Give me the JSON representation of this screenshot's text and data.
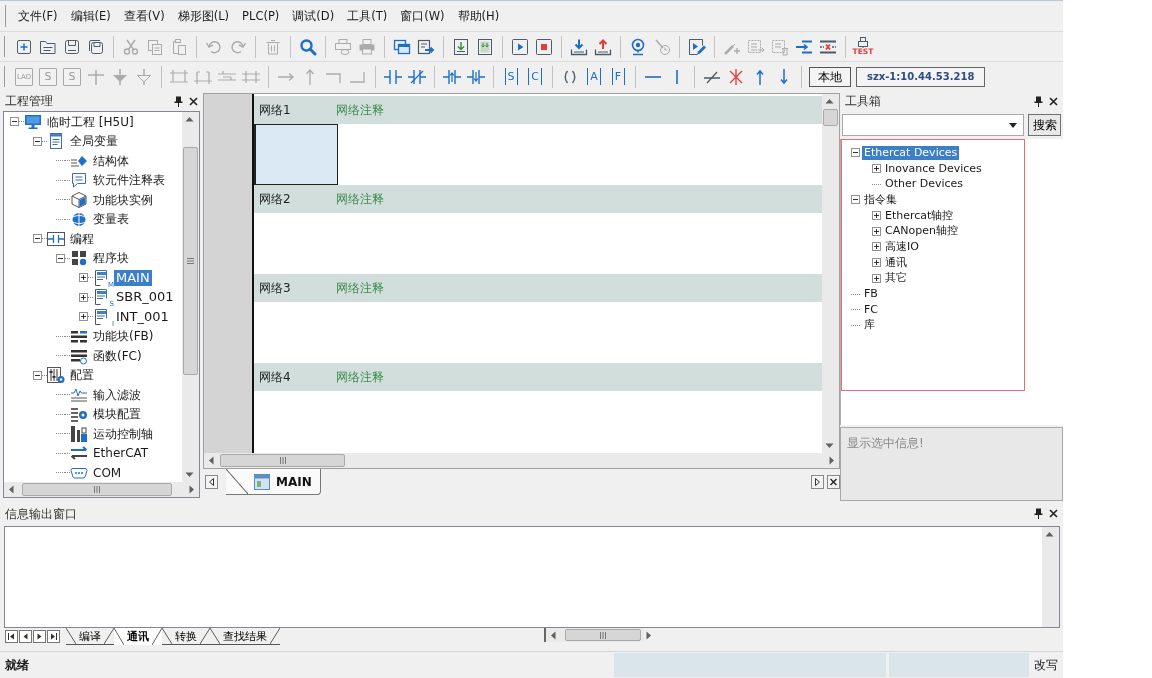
{
  "menu_bar": [
    "文件(F)",
    "编辑(E)",
    "查看(V)",
    "梯形图(L)",
    "PLC(P)",
    "调试(D)",
    "工具(T)",
    "窗口(W)",
    "帮助(H)"
  ],
  "toolbar_1": [
    [
      {
        "disabled": false
      },
      {
        "disabled": false
      },
      {
        "disabled": false
      },
      {
        "disabled": false
      }
    ],
    [
      {
        "disabled": true
      },
      {
        "disabled": true
      },
      {
        "disabled": true
      }
    ],
    [
      {
        "disabled": true
      },
      {
        "disabled": true
      }
    ],
    [
      {
        "disabled": true
      }
    ],
    [
      {
        "disabled": false
      }
    ],
    [
      {
        "disabled": true
      },
      {
        "disabled": true
      }
    ],
    [
      {
        "disabled": false
      },
      {
        "disabled": false
      }
    ],
    [
      {
        "disabled": false
      },
      {
        "disabled": false
      }
    ],
    [
      {
        "disabled": false
      },
      {
        "disabled": false
      }
    ],
    [
      {
        "disabled": false
      },
      {
        "disabled": false
      }
    ],
    [
      {
        "disabled": false
      },
      {
        "disabled": true
      }
    ],
    [
      {
        "disabled": false
      }
    ],
    [
      {
        "disabled": true
      },
      {
        "disabled": true
      },
      {
        "disabled": true
      },
      {
        "disabled": false
      },
      {
        "disabled": false
      }
    ],
    [
      {
        "disabled": false,
        "label": "TEST"
      }
    ]
  ],
  "toolbar_2": [
    [
      {
        "disabled": true,
        "label": "LAD"
      },
      {
        "disabled": true,
        "label": "S"
      },
      {
        "disabled": true,
        "label": "S"
      },
      {
        "disabled": true
      },
      {
        "disabled": true
      },
      {
        "disabled": true
      }
    ],
    [
      {
        "disabled": true
      },
      {
        "disabled": true
      },
      {
        "disabled": true
      },
      {
        "disabled": true
      }
    ],
    [
      {
        "disabled": true
      },
      {
        "disabled": true
      },
      {
        "disabled": true
      },
      {
        "disabled": true
      }
    ],
    [
      {
        "disabled": false
      },
      {
        "disabled": false
      }
    ],
    [
      {
        "disabled": false
      },
      {
        "disabled": false
      }
    ],
    [
      {
        "disabled": false,
        "label": "S"
      },
      {
        "disabled": false,
        "label": "C"
      }
    ],
    [
      {
        "disabled": false
      },
      {
        "disabled": false,
        "label": "A"
      },
      {
        "disabled": false,
        "label": "F"
      }
    ],
    [
      {
        "disabled": false
      },
      {
        "disabled": false
      }
    ],
    [
      {
        "disabled": false
      },
      {
        "disabled": false
      },
      {
        "disabled": false
      },
      {
        "disabled": false
      }
    ]
  ],
  "connection": {
    "mode_button": "本地",
    "address": "szx-1:10.44.53.218"
  },
  "project_panel": {
    "title": "工程管理",
    "tree": [
      {
        "label": "临时工程 [H5U]",
        "kind": "project",
        "expanded": true,
        "selected": false,
        "children": [
          {
            "label": "全局变量",
            "kind": "global-variables",
            "expanded": true,
            "selected": false,
            "children": [
              {
                "label": "结构体",
                "kind": "struct",
                "selected": false
              },
              {
                "label": "软元件注释表",
                "kind": "comment-table",
                "selected": false
              },
              {
                "label": "功能块实例",
                "kind": "fb-instance",
                "selected": false
              },
              {
                "label": "变量表",
                "kind": "variable-table",
                "selected": false
              }
            ]
          },
          {
            "label": "编程",
            "kind": "programming",
            "expanded": true,
            "selected": false,
            "children": [
              {
                "label": "程序块",
                "kind": "program-blocks",
                "expanded": true,
                "selected": false,
                "children": [
                  {
                    "label": "MAIN",
                    "kind": "program",
                    "tag": "M",
                    "expanded": false,
                    "selected": true
                  },
                  {
                    "label": "SBR_001",
                    "kind": "program",
                    "tag": "S",
                    "expanded": false,
                    "selected": false
                  },
                  {
                    "label": "INT_001",
                    "kind": "program",
                    "tag": "I",
                    "expanded": false,
                    "selected": false
                  }
                ]
              },
              {
                "label": "功能块(FB)",
                "kind": "function-block",
                "selected": false
              },
              {
                "label": "函数(FC)",
                "kind": "function",
                "selected": false
              }
            ]
          },
          {
            "label": "配置",
            "kind": "configuration",
            "expanded": true,
            "selected": false,
            "children": [
              {
                "label": "输入滤波",
                "kind": "input-filter",
                "selected": false
              },
              {
                "label": "模块配置",
                "kind": "module-config",
                "selected": false
              },
              {
                "label": "运动控制轴",
                "kind": "motion-axis",
                "selected": false
              },
              {
                "label": "EtherCAT",
                "kind": "ethercat",
                "selected": false
              },
              {
                "label": "COM",
                "kind": "com",
                "selected": false
              }
            ]
          }
        ]
      }
    ]
  },
  "editor": {
    "networks": [
      {
        "label": "网络1",
        "comment": "网络注释",
        "cursor": true
      },
      {
        "label": "网络2",
        "comment": "网络注释",
        "cursor": false
      },
      {
        "label": "网络3",
        "comment": "网络注释",
        "cursor": false
      },
      {
        "label": "网络4",
        "comment": "网络注释",
        "cursor": false
      }
    ],
    "tabs": [
      {
        "label": "MAIN",
        "selected": true
      }
    ]
  },
  "toolbox": {
    "title": "工具箱",
    "search_button": "搜索",
    "tree": [
      {
        "label": "Ethercat Devices",
        "expanded": true,
        "selected": true,
        "children": [
          {
            "label": "Inovance Devices",
            "expanded": false,
            "selected": false
          },
          {
            "label": "Other Devices",
            "selected": false
          }
        ]
      },
      {
        "label": "指令集",
        "expanded": true,
        "selected": false,
        "children": [
          {
            "label": "Ethercat轴控",
            "expanded": false,
            "selected": false
          },
          {
            "label": "CANopen轴控",
            "expanded": false,
            "selected": false
          },
          {
            "label": "高速IO",
            "expanded": false,
            "selected": false
          },
          {
            "label": "通讯",
            "expanded": false,
            "selected": false
          },
          {
            "label": "其它",
            "expanded": false,
            "selected": false
          }
        ]
      },
      {
        "label": "FB",
        "selected": false
      },
      {
        "label": "FC",
        "selected": false
      },
      {
        "label": "库",
        "selected": false
      }
    ],
    "info": "显示选中信息!"
  },
  "output_panel": {
    "title": "信息输出窗口",
    "tabs": [
      {
        "label": "编译",
        "selected": false
      },
      {
        "label": "通讯",
        "selected": true
      },
      {
        "label": "转换",
        "selected": false
      },
      {
        "label": "查找结果",
        "selected": false
      }
    ]
  },
  "status_bar": {
    "message": "就绪",
    "mode": "改写"
  }
}
